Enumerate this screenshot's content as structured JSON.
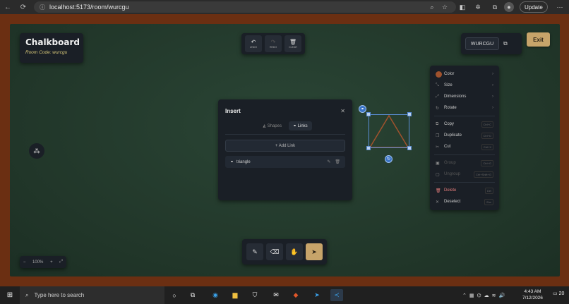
{
  "browser": {
    "url": "localhost:5173/room/wurcgu",
    "update_label": "Update",
    "back_icon": "back-arrow-icon",
    "forward_icon": "forward-arrow-icon",
    "refresh_icon": "refresh-icon"
  },
  "header": {
    "title": "Chalkboard",
    "room_code_label": "Room Code: wurcgu"
  },
  "toolbar_top": {
    "undo": "UNDO",
    "redo": "REDO",
    "clear": "CLEAR"
  },
  "room_code": {
    "code": "WURCGU"
  },
  "exit_label": "Exit",
  "insert_modal": {
    "title": "Insert",
    "tabs": [
      {
        "label": "Shapes",
        "active": false
      },
      {
        "label": "Links",
        "active": true
      }
    ],
    "add_link_label": "+ Add Link",
    "links": [
      {
        "label": "triangle"
      }
    ]
  },
  "context_menu": {
    "items": [
      {
        "label": "Color",
        "icon": "color-swatch-icon",
        "shortcut": "",
        "chevron": true,
        "state": "normal"
      },
      {
        "label": "Size",
        "icon": "size-icon",
        "shortcut": "",
        "chevron": true,
        "state": "normal"
      },
      {
        "label": "Dimensions",
        "icon": "dimensions-icon",
        "shortcut": "",
        "chevron": true,
        "state": "normal"
      },
      {
        "label": "Rotate",
        "icon": "rotate-icon",
        "shortcut": "",
        "chevron": true,
        "state": "normal"
      },
      {
        "label": "Copy",
        "icon": "copy-icon",
        "shortcut": "Ctrl+C",
        "chevron": false,
        "state": "normal"
      },
      {
        "label": "Duplicate",
        "icon": "duplicate-icon",
        "shortcut": "Ctrl+D",
        "chevron": false,
        "state": "normal"
      },
      {
        "label": "Cut",
        "icon": "cut-icon",
        "shortcut": "Ctrl+X",
        "chevron": false,
        "state": "normal"
      },
      {
        "label": "Group",
        "icon": "group-icon",
        "shortcut": "Ctrl+G",
        "chevron": false,
        "state": "disabled"
      },
      {
        "label": "Ungroup",
        "icon": "ungroup-icon",
        "shortcut": "Ctrl+Shift+G",
        "chevron": false,
        "state": "disabled"
      },
      {
        "label": "Delete",
        "icon": "trash-icon",
        "shortcut": "Del",
        "chevron": false,
        "state": "danger"
      },
      {
        "label": "Deselect",
        "icon": "close-icon",
        "shortcut": "Esc",
        "chevron": false,
        "state": "normal"
      }
    ],
    "color_value": "#a0522d"
  },
  "zoom": {
    "level": "100%"
  },
  "taskbar": {
    "search_placeholder": "Type here to search",
    "time": "4:43 AM",
    "date": "7/12/2026",
    "notification_count": "20"
  },
  "colors": {
    "accent": "#c7a46a",
    "board": "#243b2e",
    "frame": "#6b2f12",
    "selection": "#5b8ed6",
    "triangle_stroke": "#a0522d"
  }
}
